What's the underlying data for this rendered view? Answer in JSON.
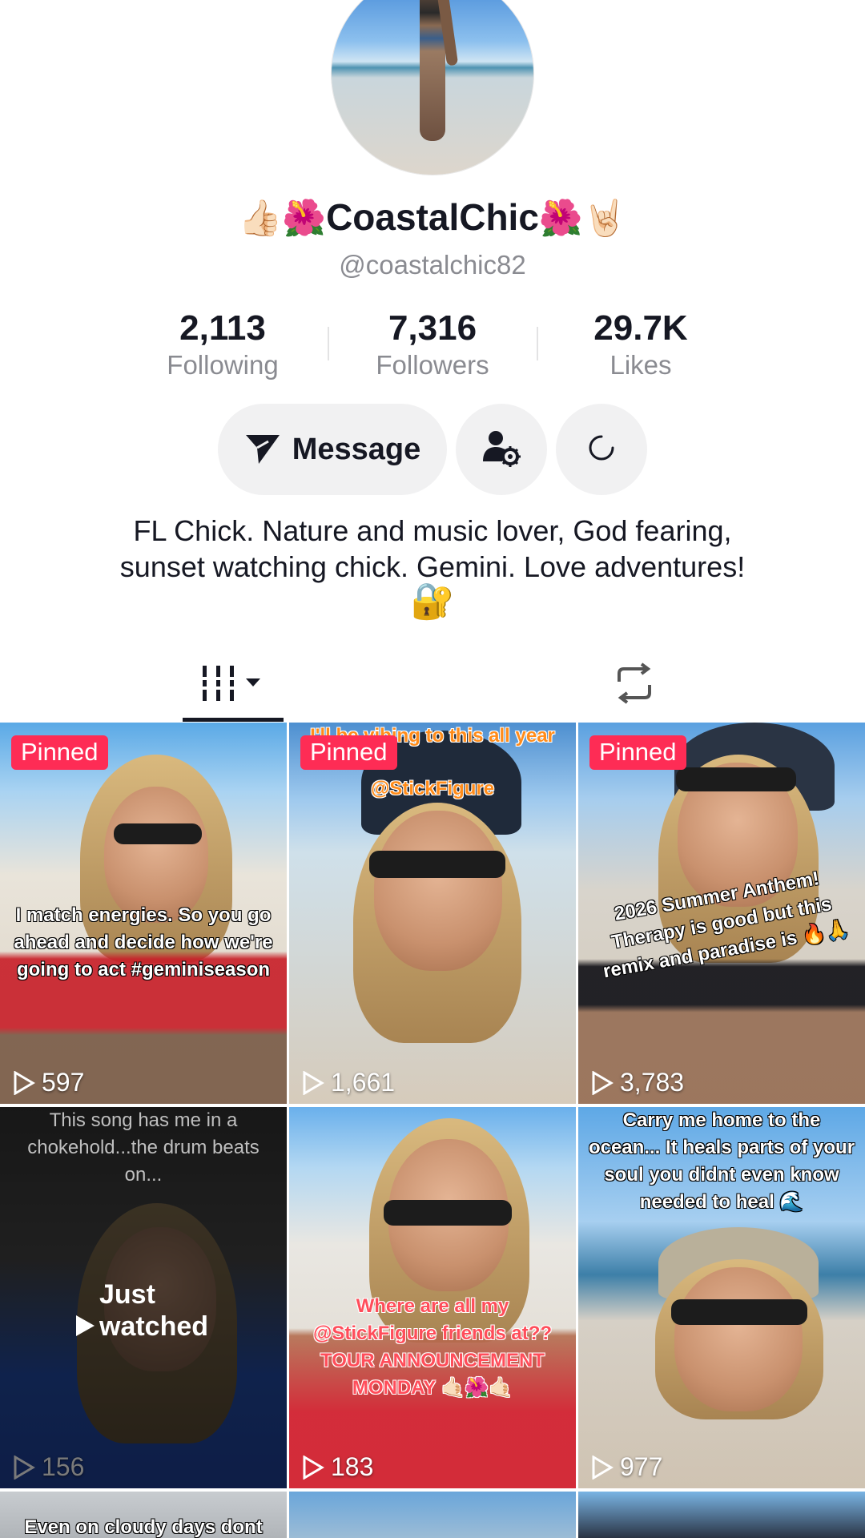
{
  "profile": {
    "display_name": "CoastalChic",
    "name_emoji_left": "👍🏻🌺",
    "name_emoji_right": "🌺🤘🏻",
    "handle": "@coastalchic82",
    "bio_line1": "FL Chick. Nature and music lover, God fearing,",
    "bio_line2": "sunset watching chick. Gemini. Love adventures!",
    "bio_emoji": "🔐"
  },
  "stats": {
    "following_value": "2,113",
    "following_label": "Following",
    "followers_value": "7,316",
    "followers_label": "Followers",
    "likes_value": "29.7K",
    "likes_label": "Likes"
  },
  "actions": {
    "message_label": "Message",
    "message_icon": "send-icon",
    "settings_icon": "user-gear-icon",
    "loading_icon": "spinner-icon"
  },
  "tabs": {
    "videos_icon": "grid-icon",
    "reposts_icon": "repost-icon"
  },
  "videos": [
    {
      "pinned_label": "Pinned",
      "views": "597",
      "caption": "I match energies. So you go ahead and decide how we're going to act #geminiseason"
    },
    {
      "pinned_label": "Pinned",
      "views": "1,661",
      "caption_top": "I'll be vibing to this all year",
      "caption": "@StickFigure"
    },
    {
      "pinned_label": "Pinned",
      "views": "3,783",
      "caption": "2026 Summer Anthem! Therapy is good but this remix and paradise is 🔥🙏"
    },
    {
      "views": "156",
      "caption": "This song has me in a chokehold...the drum beats on...",
      "overlay_label": "Just watched"
    },
    {
      "views": "183",
      "caption": "Where are all my @StickFigure friends at?? TOUR ANNOUNCEMENT MONDAY 🤙🏻🌺🤙🏻"
    },
    {
      "views": "977",
      "caption": "Carry me home to the ocean... It heals parts of your soul you didnt even know needed to heal 🌊"
    },
    {
      "caption": "Even on cloudy days dont"
    }
  ],
  "colors": {
    "accent_pinned": "#fe2c55",
    "text_primary": "#161823",
    "text_secondary": "#8a8b91",
    "button_bg": "#f1f1f2"
  }
}
